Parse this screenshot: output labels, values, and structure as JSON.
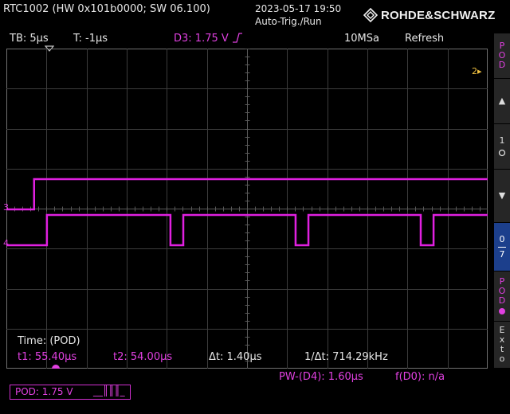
{
  "header": {
    "device": "RTC1002 (HW 0x101b0000; SW 06.100)",
    "datetime": "2023-05-17 19:50",
    "run_state": "Auto-Trig./Run",
    "brand": "ROHDE&SCHWARZ"
  },
  "status": {
    "timebase": "TB: 5µs",
    "trigger_offset": "T: -1µs",
    "trigger_source": "D3: 1.75 V",
    "sample_rate": "10MSa",
    "mode": "Refresh"
  },
  "display": {
    "marker_label": "2▸",
    "channel3_label": "3",
    "channel4_label": "4",
    "colors": {
      "digital": "#e020e0",
      "grid": "#3c3c3c",
      "accent": "#1c3f8c"
    },
    "channel3": {
      "low_before_us": -18.6,
      "edge_us": -18.6,
      "state_after": "high"
    },
    "channel4": {
      "name": "D4",
      "edges_us": [
        {
          "t": -17.0,
          "to": "high"
        },
        {
          "t": -1.6,
          "to": "low"
        },
        {
          "t": 0.0,
          "to": "high"
        },
        {
          "t": 14.0,
          "to": "low"
        },
        {
          "t": 15.6,
          "to": "high"
        },
        {
          "t": 29.6,
          "to": "low"
        },
        {
          "t": 31.2,
          "to": "high"
        }
      ]
    }
  },
  "measurements": {
    "time_title": "Time: (POD)",
    "t1": "t1: 55.40µs",
    "t2": "t2: 54.00µs",
    "dt": "Δt: 1.40µs",
    "inv_dt": "1/Δt: 714.29kHz",
    "pulse_width": "PW-(D4): 1.60µs",
    "frequency": "f(D0): n/a"
  },
  "pod_box": {
    "level": "POD: 1.75 V",
    "bits": "__║║║_"
  },
  "side_menu": {
    "pod_top": [
      "P",
      "O",
      "D"
    ],
    "up_arrow": "▲",
    "one_label": "1",
    "down_arrow": "▼",
    "range_top": "0",
    "range_bottom": "7",
    "pod_bottom": [
      "P",
      "O",
      "D"
    ],
    "ext": [
      "E",
      "x",
      "t",
      "o"
    ]
  }
}
